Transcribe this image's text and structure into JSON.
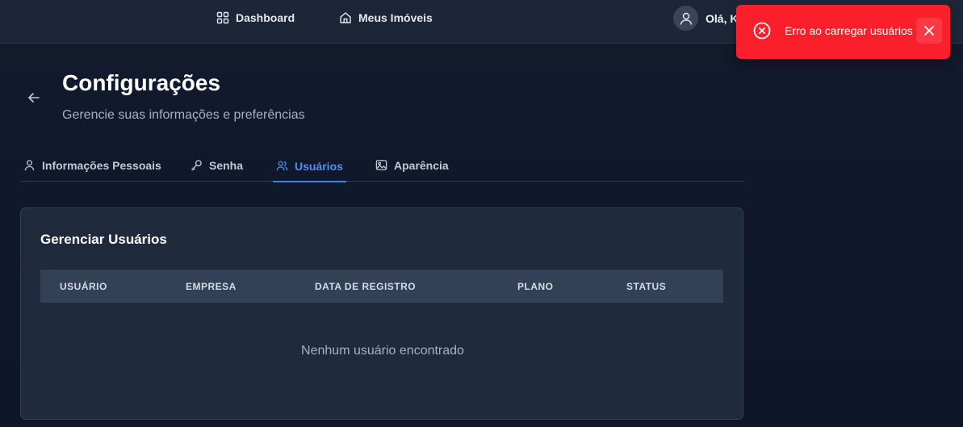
{
  "topnav": {
    "dashboard_label": "Dashboard",
    "imoveis_label": "Meus Imóveis",
    "user_greeting": "Olá, K"
  },
  "header": {
    "title": "Configurações",
    "subtitle": "Gerencie suas informações e preferências"
  },
  "tabs": [
    {
      "label": "Informações Pessoais",
      "icon": "user-icon"
    },
    {
      "label": "Senha",
      "icon": "key-icon"
    },
    {
      "label": "Usuários",
      "icon": "users-icon",
      "active": true
    },
    {
      "label": "Aparência",
      "icon": "image-icon"
    }
  ],
  "users_card": {
    "title": "Gerenciar Usuários",
    "columns": [
      "USUÁRIO",
      "EMPRESA",
      "DATA DE REGISTRO",
      "PLANO",
      "STATUS"
    ],
    "empty_message": "Nenhum usuário encontrado"
  },
  "toast": {
    "message": "Erro ao carregar usuários",
    "color": "#fb1f2c"
  },
  "colors": {
    "accent": "#3b82f6",
    "background": "#111827",
    "card": "#1f2a3d"
  }
}
